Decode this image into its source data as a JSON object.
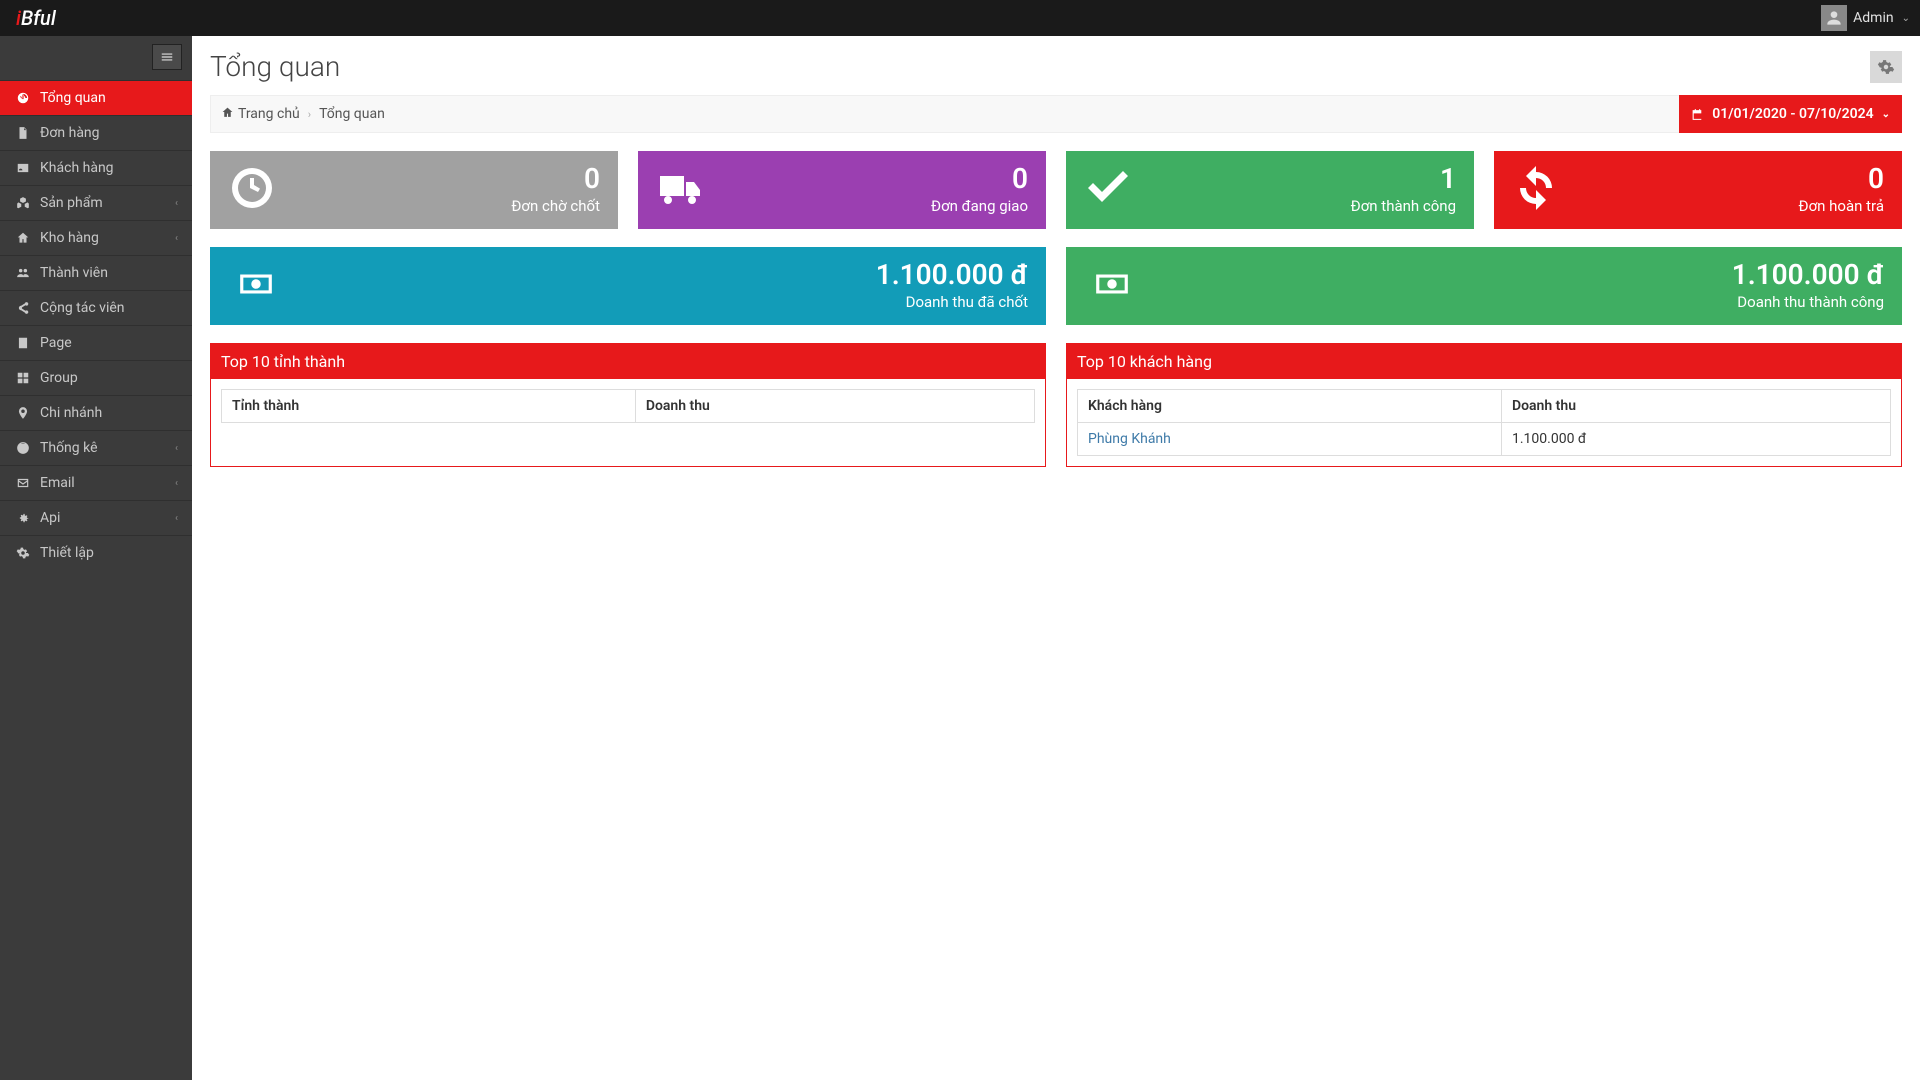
{
  "brand": {
    "prefix": "i",
    "rest": "Bful"
  },
  "user": {
    "name": "Admin"
  },
  "page": {
    "title": "Tổng quan"
  },
  "breadcrumb": {
    "home": "Trang chủ",
    "current": "Tổng quan"
  },
  "date_range": "01/01/2020 - 07/10/2024",
  "sidebar": {
    "items": [
      {
        "label": "Tổng quan",
        "icon": "dashboard",
        "active": true,
        "expandable": false
      },
      {
        "label": "Đơn hàng",
        "icon": "file",
        "active": false,
        "expandable": false
      },
      {
        "label": "Khách hàng",
        "icon": "vcard",
        "active": false,
        "expandable": false
      },
      {
        "label": "Sản phẩm",
        "icon": "cubes",
        "active": false,
        "expandable": true
      },
      {
        "label": "Kho hàng",
        "icon": "home",
        "active": false,
        "expandable": true
      },
      {
        "label": "Thành viên",
        "icon": "users",
        "active": false,
        "expandable": false
      },
      {
        "label": "Cộng tác viên",
        "icon": "share",
        "active": false,
        "expandable": false
      },
      {
        "label": "Page",
        "icon": "doc",
        "active": false,
        "expandable": false
      },
      {
        "label": "Group",
        "icon": "grid",
        "active": false,
        "expandable": false
      },
      {
        "label": "Chi nhánh",
        "icon": "pin",
        "active": false,
        "expandable": false
      },
      {
        "label": "Thống kê",
        "icon": "globe",
        "active": false,
        "expandable": true
      },
      {
        "label": "Email",
        "icon": "mail",
        "active": false,
        "expandable": true
      },
      {
        "label": "Api",
        "icon": "cog",
        "active": false,
        "expandable": true
      },
      {
        "label": "Thiết lập",
        "icon": "gear",
        "active": false,
        "expandable": false
      }
    ]
  },
  "widgets": [
    {
      "value": "0",
      "label": "Đơn chờ chốt",
      "icon": "clock",
      "color": "c-grey"
    },
    {
      "value": "0",
      "label": "Đơn đang giao",
      "icon": "truck",
      "color": "c-purple"
    },
    {
      "value": "1",
      "label": "Đơn thành công",
      "icon": "check",
      "color": "c-green"
    },
    {
      "value": "0",
      "label": "Đơn hoàn trả",
      "icon": "refresh",
      "color": "c-red"
    }
  ],
  "revenue": [
    {
      "value": "1.100.000 đ",
      "label": "Doanh thu đã chốt",
      "color": "c-teal"
    },
    {
      "value": "1.100.000 đ",
      "label": "Doanh thu thành công",
      "color": "c-green"
    }
  ],
  "panels": {
    "provinces": {
      "title": "Top 10 tỉnh thành",
      "col1": "Tỉnh thành",
      "col2": "Doanh thu",
      "rows": []
    },
    "customers": {
      "title": "Top 10 khách hàng",
      "col1": "Khách hàng",
      "col2": "Doanh thu",
      "rows": [
        {
          "name": "Phùng Khánh",
          "revenue": "1.100.000 đ"
        }
      ]
    }
  }
}
